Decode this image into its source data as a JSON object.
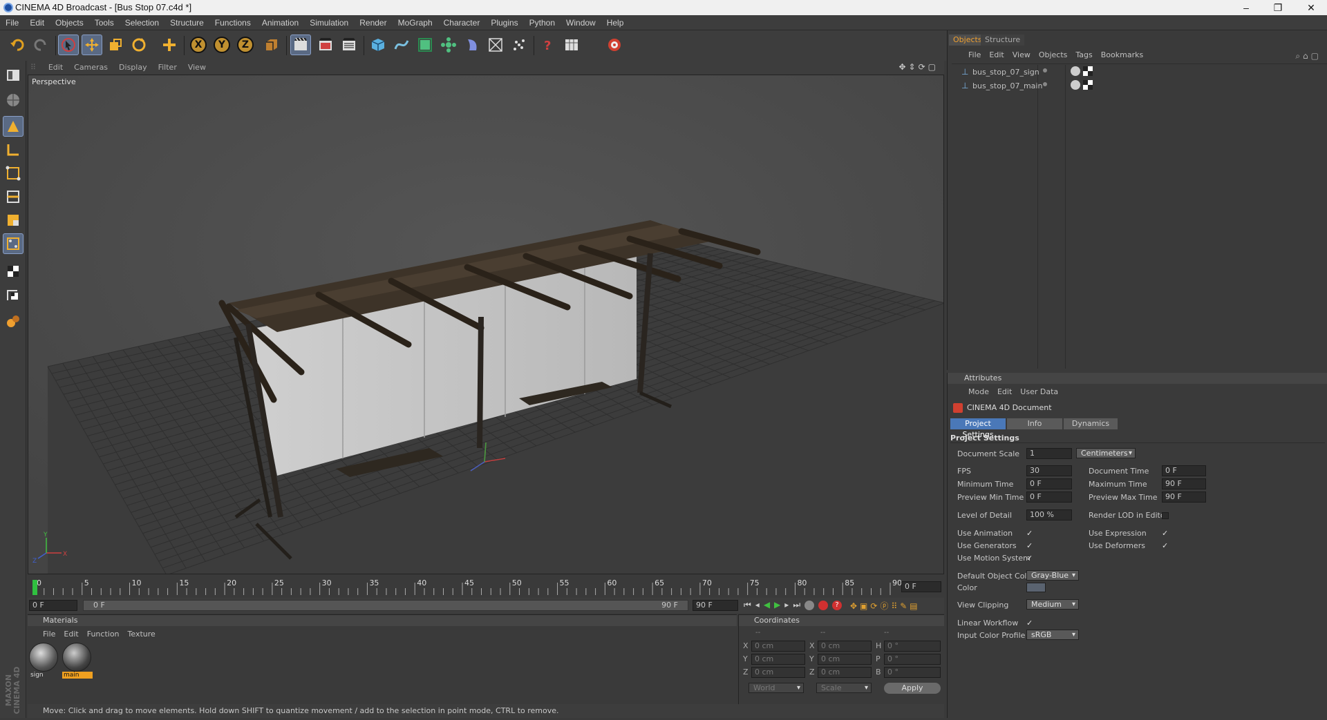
{
  "window": {
    "title": "CINEMA 4D Broadcast - [Bus Stop 07.c4d *]"
  },
  "menu": [
    "File",
    "Edit",
    "Objects",
    "Tools",
    "Selection",
    "Structure",
    "Functions",
    "Animation",
    "Simulation",
    "Render",
    "MoGraph",
    "Character",
    "Plugins",
    "Python",
    "Window",
    "Help"
  ],
  "viewport": {
    "menu": [
      "Edit",
      "Cameras",
      "Display",
      "Filter",
      "View"
    ],
    "name": "Perspective",
    "axes": {
      "x": "X",
      "y": "Y",
      "z": "Z"
    }
  },
  "timeline": {
    "ticks": [
      "0",
      "5",
      "10",
      "15",
      "20",
      "25",
      "30",
      "35",
      "40",
      "45",
      "50",
      "55",
      "60",
      "65",
      "70",
      "75",
      "80",
      "85",
      "90"
    ],
    "current_frame": "0 F",
    "start": "0 F",
    "range_start": "0 F",
    "range_end": "90 F",
    "end": "90 F"
  },
  "materials": {
    "title": "Materials",
    "menu": [
      "File",
      "Edit",
      "Function",
      "Texture"
    ],
    "items": [
      {
        "name": "sign",
        "selected": false
      },
      {
        "name": "main",
        "selected": true
      }
    ]
  },
  "coordinates": {
    "title": "Coordinates",
    "headers": [
      "--",
      "--",
      "--"
    ],
    "rows": [
      {
        "a": "X",
        "av": "0 cm",
        "b": "X",
        "bv": "0 cm",
        "c": "H",
        "cv": "0 °"
      },
      {
        "a": "Y",
        "av": "0 cm",
        "b": "Y",
        "bv": "0 cm",
        "c": "P",
        "cv": "0 °"
      },
      {
        "a": "Z",
        "av": "0 cm",
        "b": "Z",
        "bv": "0 cm",
        "c": "B",
        "cv": "0 °"
      }
    ],
    "mode1": "World",
    "mode2": "Scale",
    "apply": "Apply"
  },
  "status": "Move: Click and drag to move elements. Hold down SHIFT to quantize movement / add to the selection in point mode, CTRL to remove.",
  "objects": {
    "tabs": [
      "Objects",
      "Structure"
    ],
    "menu": [
      "File",
      "Edit",
      "View",
      "Objects",
      "Tags",
      "Bookmarks"
    ],
    "items": [
      "bus_stop_07_sign",
      "bus_stop_07_main"
    ]
  },
  "attributes": {
    "title": "Attributes",
    "menu": [
      "Mode",
      "Edit",
      "User Data"
    ],
    "object": "CINEMA 4D Document",
    "tabs": [
      "Project Settings",
      "Info",
      "Dynamics"
    ],
    "section": "Project Settings",
    "document_scale_label": "Document Scale",
    "document_scale": "1",
    "document_scale_unit": "Centimeters",
    "fps_label": "FPS",
    "fps": "30",
    "document_time_label": "Document Time",
    "document_time": "0 F",
    "min_time_label": "Minimum Time",
    "min_time": "0 F",
    "max_time_label": "Maximum Time",
    "max_time": "90 F",
    "prev_min_label": "Preview Min Time",
    "prev_min": "0 F",
    "prev_max_label": "Preview Max Time",
    "prev_max": "90 F",
    "lod_label": "Level of Detail",
    "lod": "100 %",
    "render_lod_label": "Render LOD in Editor",
    "use_animation": "Use Animation",
    "use_expression": "Use Expression",
    "use_generators": "Use Generators",
    "use_deformers": "Use Deformers",
    "use_motion": "Use Motion System",
    "check": "✓",
    "default_color_label": "Default Object Color",
    "default_color": "Gray-Blue",
    "color_label": "Color",
    "view_clipping_label": "View Clipping",
    "view_clipping": "Medium",
    "linear_workflow_label": "Linear Workflow",
    "input_profile_label": "Input Color Profile",
    "input_profile": "sRGB"
  },
  "branding": "MAXON CINEMA 4D"
}
